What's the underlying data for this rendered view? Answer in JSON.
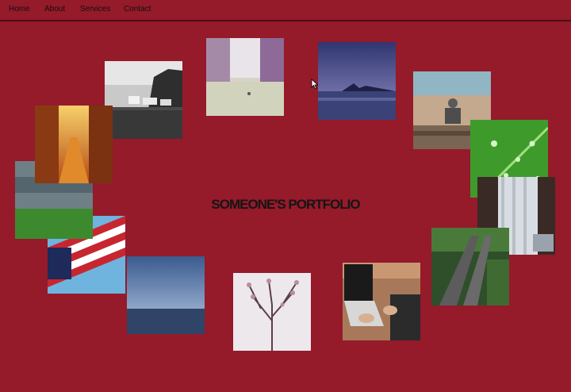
{
  "nav": {
    "items": [
      {
        "label": "Home"
      },
      {
        "label": "About"
      },
      {
        "label": "Services"
      },
      {
        "label": "Contact"
      }
    ]
  },
  "hero": {
    "title": "SOMEONE'S PORTFOLIO"
  },
  "gallery": {
    "tiles": [
      {
        "icon": "coastal-village-photo"
      },
      {
        "icon": "misty-lake-photo"
      },
      {
        "icon": "mountain-twilight-lake-photo"
      },
      {
        "icon": "bench-statue-photo"
      },
      {
        "icon": "dewdrop-leaf-photo"
      },
      {
        "icon": "window-curtain-photo"
      },
      {
        "icon": "forest-railway-photo"
      },
      {
        "icon": "laptop-typing-photo"
      },
      {
        "icon": "blossom-branches-photo"
      },
      {
        "icon": "ocean-horizon-photo"
      },
      {
        "icon": "american-flag-photo"
      },
      {
        "icon": "stormy-field-photo"
      },
      {
        "icon": "sunlit-street-photo"
      }
    ]
  },
  "colors": {
    "background": "#951a2a",
    "nav_border": "#4a0d15",
    "text": "#151515"
  }
}
